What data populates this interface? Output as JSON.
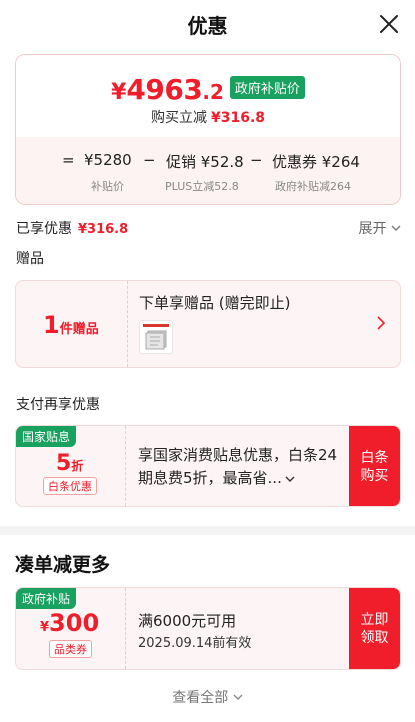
{
  "header": {
    "title": "优惠"
  },
  "summary": {
    "currency": "¥",
    "price_int": "4963",
    "price_dec": ".2",
    "gov_tag": "政府补贴价",
    "reduce_label": "购买立减",
    "reduce_amount": "¥316.8",
    "calc": {
      "eq": "=",
      "minus": "−",
      "subsidy_price": "¥5280",
      "promo": "促销 ¥52.8",
      "coupon": "优惠券 ¥264",
      "subsidy_price_label": "补贴价",
      "promo_label": "PLUS立减52.8",
      "coupon_label": "政府补贴减264"
    }
  },
  "enjoyed": {
    "label": "已享优惠",
    "amount": "¥316.8",
    "expand": "展开"
  },
  "gift": {
    "section_label": "赠品",
    "count": "1",
    "count_unit": "件赠品",
    "title": "下单享赠品 (赠完即止)"
  },
  "pay": {
    "section_label": "支付再享优惠",
    "tag": "国家贴息",
    "value": "5",
    "unit": "折",
    "sub": "白条优惠",
    "desc": "享国家消费贴息优惠，白条24期息费5折，最高省...",
    "button_line1": "白条",
    "button_line2": "购买"
  },
  "more": {
    "title": "凑单减更多",
    "coupon": {
      "tag": "政府补贴",
      "currency": "¥",
      "value": "300",
      "sub": "品类券",
      "line1": "满6000元可用",
      "line2": "2025.09.14前有效",
      "button_line1": "立即",
      "button_line2": "领取"
    },
    "view_all": "查看全部"
  },
  "colors": {
    "accent": "#f01d2a",
    "green": "#19a15f",
    "card_bg": "#fdf5f5"
  }
}
